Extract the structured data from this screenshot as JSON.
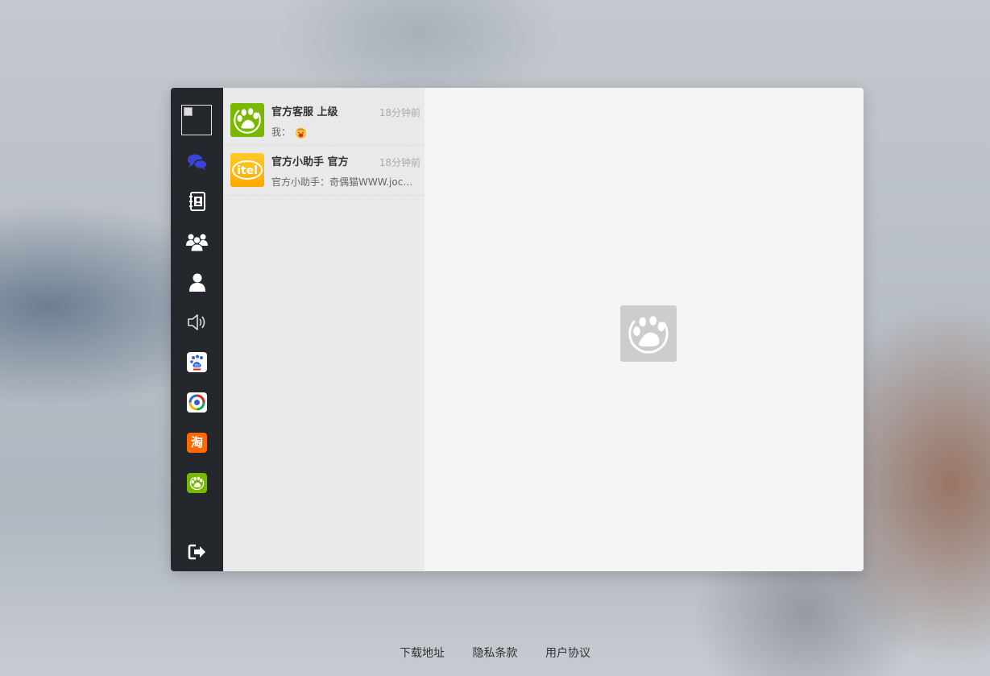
{
  "sidebar": {
    "nav": [
      {
        "icon": "chat-bubbles-icon",
        "active": true
      },
      {
        "icon": "contacts-book-icon"
      },
      {
        "icon": "group-icon"
      },
      {
        "icon": "user-icon"
      },
      {
        "icon": "speaker-icon"
      },
      {
        "icon": "baidu-app-icon",
        "text": "du"
      },
      {
        "icon": "news-app-icon"
      },
      {
        "icon": "taobao-app-icon",
        "text": "淘"
      },
      {
        "icon": "paw-app-icon"
      }
    ],
    "logout_icon": "logout-icon",
    "active_color": "#3d43d6"
  },
  "conversations": [
    {
      "name": "官方客服 上级",
      "time": "18分钟前",
      "preview_prefix": "我：",
      "preview_has_emoji": true,
      "avatar": "paw-avatar",
      "avatar_color": "#7ab800"
    },
    {
      "name": "官方小助手 官方",
      "time": "18分钟前",
      "preview": "官方小助手：奇偶猫WWW.jocat.cn",
      "avatar": "itel-avatar",
      "avatar_text": "itel",
      "avatar_color": "#ffb400"
    }
  ],
  "main": {
    "placeholder_icon": "paw-placeholder-icon"
  },
  "footer": {
    "links": [
      "下载地址",
      "隐私条款",
      "用户协议"
    ]
  }
}
